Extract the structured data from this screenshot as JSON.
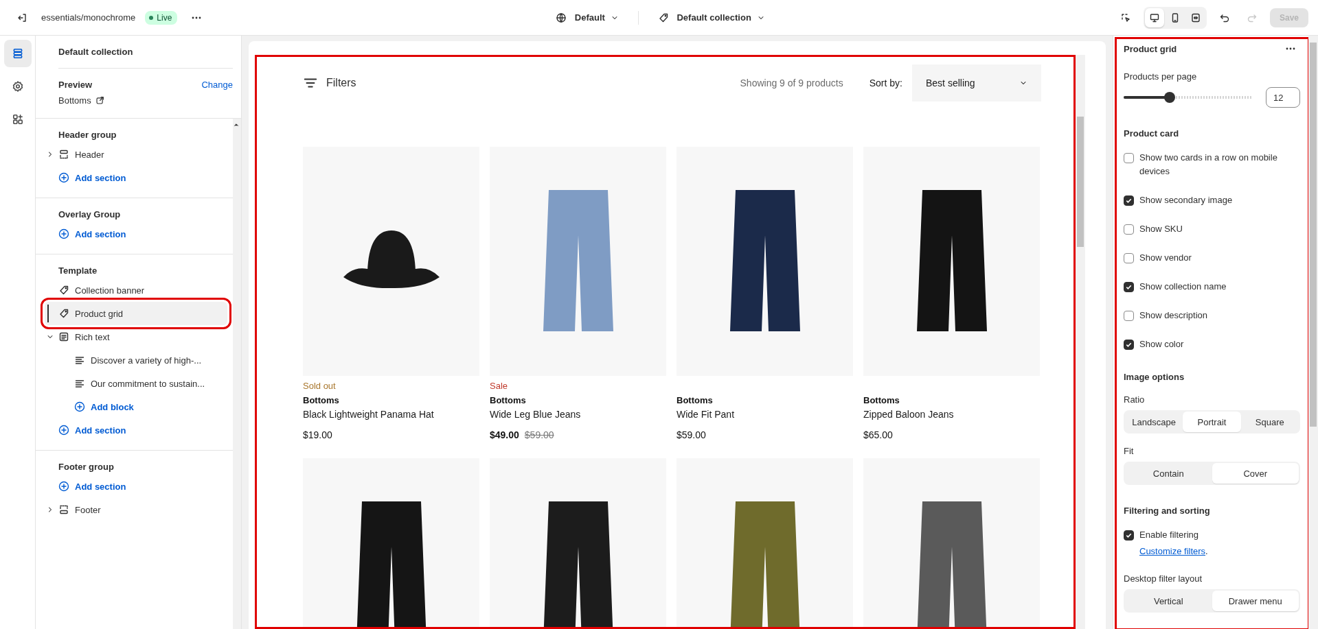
{
  "topbar": {
    "store": "essentials/monochrome",
    "status": "Live",
    "locale": "Default",
    "template": "Default collection",
    "views": [
      {
        "kind": "desktop",
        "selected": true
      },
      {
        "kind": "mobile",
        "selected": false
      },
      {
        "kind": "full",
        "selected": false
      }
    ],
    "redo_disabled": true,
    "save": {
      "label": "Save",
      "disabled": true
    }
  },
  "rail": [
    {
      "kind": "sections",
      "selected": true
    },
    {
      "kind": "settings",
      "selected": false
    },
    {
      "kind": "apps",
      "selected": false
    }
  ],
  "sidebar": {
    "title": "Default collection",
    "preview": {
      "label": "Preview",
      "value": "Bottoms",
      "action": "Change"
    },
    "groups": [
      {
        "title": "Header group",
        "items": [
          {
            "kind": "header",
            "label": "Header",
            "expanded": false
          },
          {
            "kind": "add",
            "label": "Add section"
          }
        ]
      },
      {
        "title": "Overlay Group",
        "items": [
          {
            "kind": "add",
            "label": "Add section"
          }
        ]
      },
      {
        "title": "Template",
        "items": [
          {
            "kind": "section",
            "label": "Collection banner",
            "selected": false,
            "highlighted": false
          },
          {
            "kind": "section",
            "label": "Product grid",
            "selected": true,
            "highlighted": true
          },
          {
            "kind": "text",
            "label": "Rich text",
            "expanded": true,
            "children": [
              {
                "kind": "block",
                "label": "Discover a variety of high-..."
              },
              {
                "kind": "block",
                "label": "Our commitment to sustain..."
              },
              {
                "kind": "add",
                "label": "Add block"
              }
            ]
          },
          {
            "kind": "add",
            "label": "Add section"
          }
        ]
      },
      {
        "title": "Footer group",
        "items": [
          {
            "kind": "add",
            "label": "Add section"
          },
          {
            "kind": "footer",
            "label": "Footer",
            "expanded": false
          }
        ]
      }
    ]
  },
  "preview": {
    "highlighted": true,
    "filters": "Filters",
    "count": "Showing 9 of 9 products",
    "sort_label": "Sort by:",
    "sort_value": "Best selling",
    "products": [
      {
        "kind": "hat",
        "color": "#1a1a1a",
        "badge": {
          "kind": "soldout",
          "text": "Sold out"
        },
        "vendor": "Bottoms",
        "name": "Black Lightweight Panama Hat",
        "price": "$19.00"
      },
      {
        "kind": "pants",
        "color": "#7f9cc4",
        "badge": {
          "kind": "sale",
          "text": "Sale"
        },
        "vendor": "Bottoms",
        "name": "Wide Leg Blue Jeans",
        "price": "$49.00",
        "compare_price": "$59.00"
      },
      {
        "kind": "pants",
        "color": "#1b2a4a",
        "vendor": "Bottoms",
        "name": "Wide Fit Pant",
        "price": "$59.00"
      },
      {
        "kind": "pants",
        "color": "#141414",
        "vendor": "Bottoms",
        "name": "Zipped Baloon Jeans",
        "price": "$65.00"
      },
      {
        "kind": "pants",
        "color": "#151515"
      },
      {
        "kind": "pants",
        "color": "#1c1c1c"
      },
      {
        "kind": "pants",
        "color": "#6f6b2c"
      },
      {
        "kind": "pants",
        "color": "#5a5a5a"
      }
    ]
  },
  "settings": {
    "title": "Product grid",
    "highlighted": true,
    "fields": [
      {
        "kind": "slider",
        "label": "Products per page",
        "level": 0.36,
        "value": "12"
      },
      {
        "kind": "heading",
        "label": "Product card"
      },
      {
        "kind": "checkbox",
        "label": "Show two cards in a row on mobile devices",
        "checked": false
      },
      {
        "kind": "checkbox",
        "label": "Show secondary image",
        "checked": true
      },
      {
        "kind": "checkbox",
        "label": "Show SKU",
        "checked": false
      },
      {
        "kind": "checkbox",
        "label": "Show vendor",
        "checked": false
      },
      {
        "kind": "checkbox",
        "label": "Show collection name",
        "checked": true
      },
      {
        "kind": "checkbox",
        "label": "Show description",
        "checked": false
      },
      {
        "kind": "checkbox",
        "label": "Show color",
        "checked": true
      },
      {
        "kind": "heading",
        "label": "Image options"
      },
      {
        "kind": "segmented",
        "label": "Ratio",
        "options": [
          {
            "label": "Landscape",
            "selected": false
          },
          {
            "label": "Portrait",
            "selected": true
          },
          {
            "label": "Square",
            "selected": false
          }
        ]
      },
      {
        "kind": "segmented",
        "label": "Fit",
        "options": [
          {
            "label": "Contain",
            "selected": false
          },
          {
            "label": "Cover",
            "selected": true
          }
        ]
      },
      {
        "kind": "heading",
        "label": "Filtering and sorting"
      },
      {
        "kind": "checkbox",
        "label": "Enable filtering",
        "checked": true,
        "link": "Customize filters",
        "link_suffix": "."
      },
      {
        "kind": "segmented",
        "label": "Desktop filter layout",
        "options": [
          {
            "label": "Vertical",
            "selected": false
          },
          {
            "label": "Drawer menu",
            "selected": true
          }
        ]
      }
    ]
  }
}
